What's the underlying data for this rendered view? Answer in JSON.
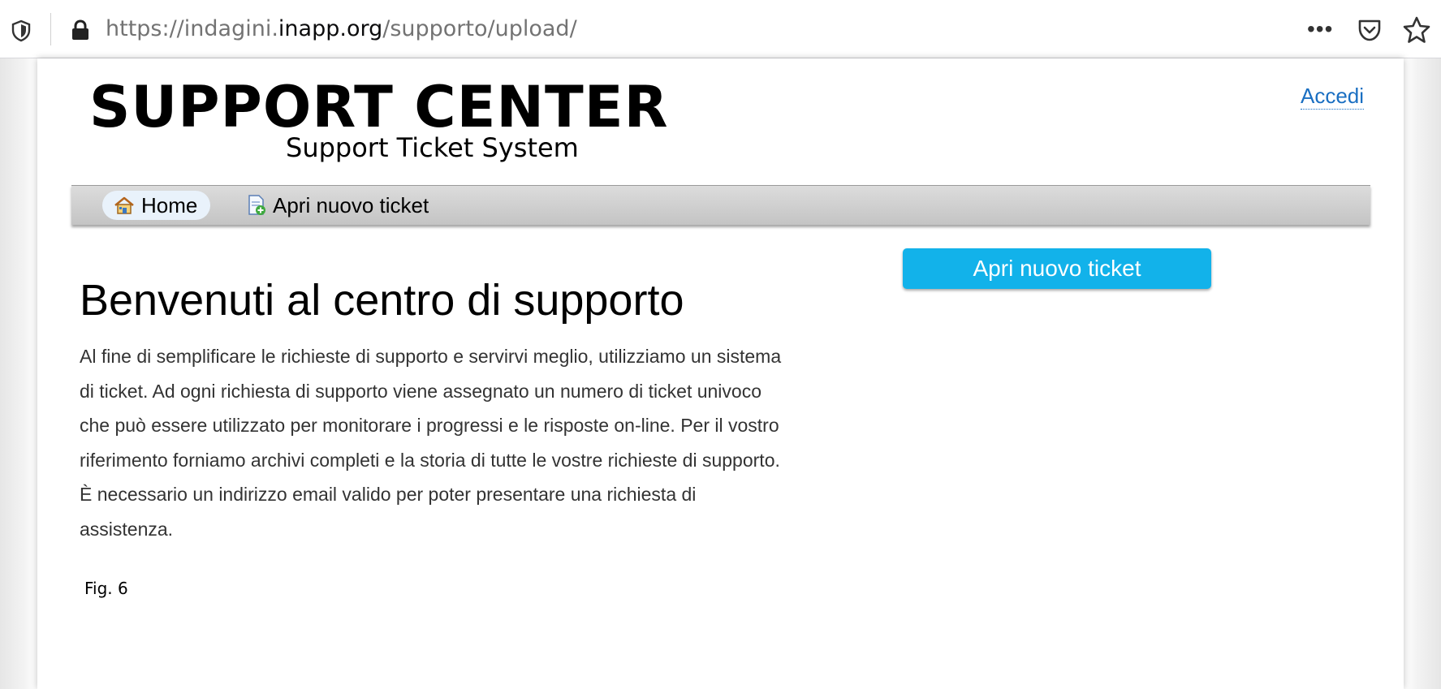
{
  "browser": {
    "url_prefix": "https://indagini.",
    "url_host": "inapp.org",
    "url_path": "/supporto/upload/",
    "more_label": "•••"
  },
  "header": {
    "title": "SUPPORT CENTER",
    "subtitle": "Support Ticket System",
    "login_label": "Accedi"
  },
  "nav": {
    "items": [
      {
        "label": "Home",
        "icon": "home-icon",
        "active": true
      },
      {
        "label": "Apri nuovo ticket",
        "icon": "new-ticket-icon",
        "active": false
      }
    ]
  },
  "main": {
    "heading": "Benvenuti al centro di supporto",
    "intro_lines": [
      "Al fine di semplificare le richieste di supporto e servirvi meglio, utilizziamo un sistema",
      "di ticket. Ad ogni richiesta di supporto viene assegnato un numero di ticket univoco",
      "che può essere utilizzato per monitorare i progressi e le risposte on-line. Per il vostro",
      "riferimento forniamo archivi completi e la storia di tutte le vostre richieste di supporto.",
      "È necessario un indirizzo email valido per poter presentare una richiesta di",
      "assistenza."
    ],
    "cta_label": "Apri nuovo ticket"
  },
  "caption": "Fig. 6",
  "colors": {
    "cta": "#12b2ea",
    "link": "#1a6fc2",
    "nav_bar": "#cfcfcf"
  }
}
